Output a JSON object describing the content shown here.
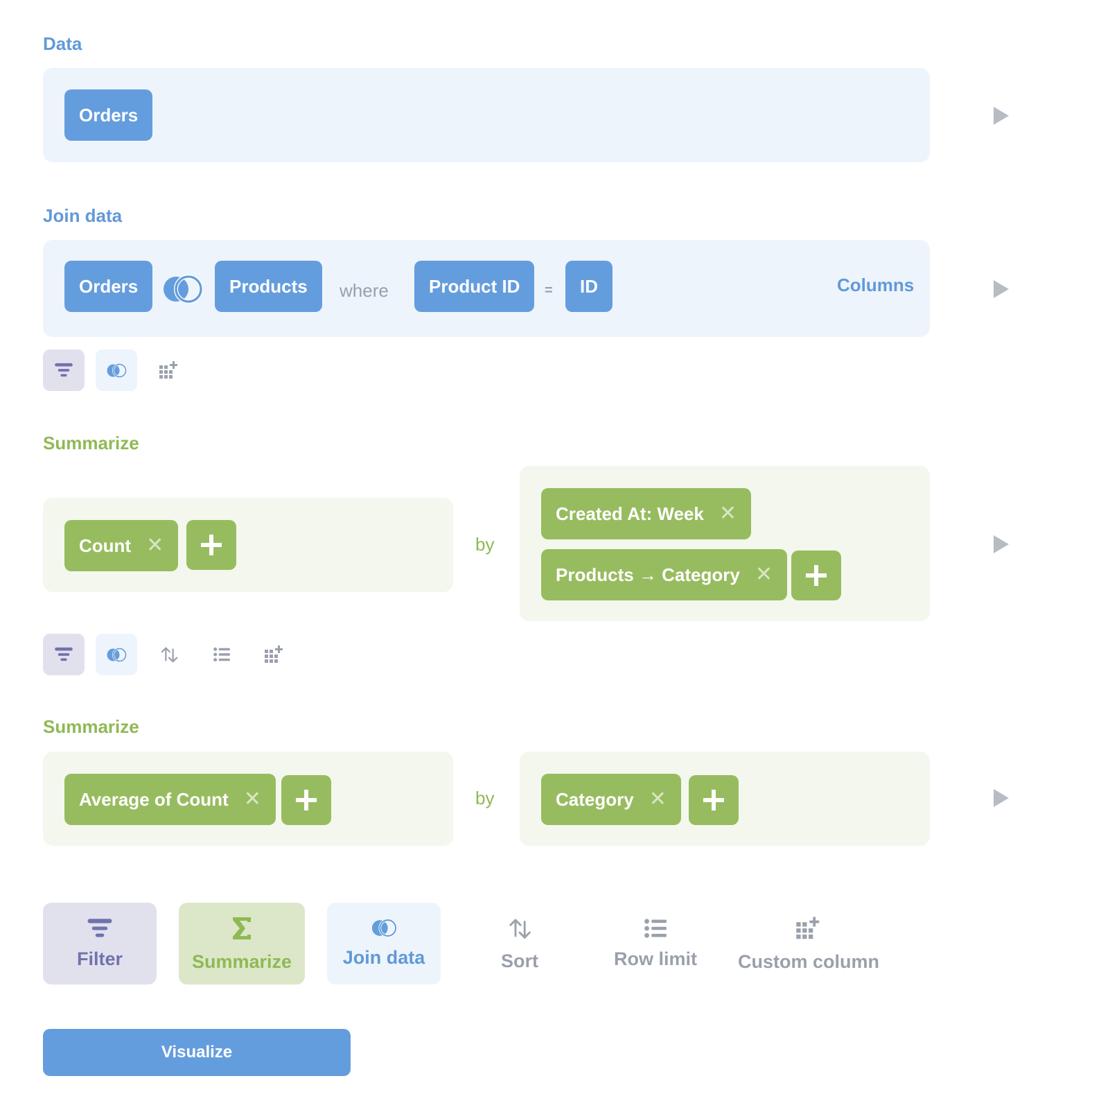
{
  "colors": {
    "data_accent": "#649ddd",
    "summarize_accent": "#97bc5f",
    "filter_accent": "#7172ad",
    "muted": "#9aa0ab"
  },
  "data_step": {
    "title": "Data",
    "source_table": "Orders"
  },
  "join_step": {
    "title": "Join data",
    "left_table": "Orders",
    "join_type_icon": "join-left-icon",
    "right_table": "Products",
    "where_label": "where",
    "left_field": "Product ID",
    "operator": "=",
    "right_field": "ID",
    "columns_label": "Columns",
    "quick_actions": [
      "filter",
      "join",
      "custom-column"
    ]
  },
  "summarize_step_1": {
    "title": "Summarize",
    "metrics": [
      {
        "label": "Count"
      }
    ],
    "by_label": "by",
    "breakouts": [
      {
        "label": "Created At: Week"
      },
      {
        "label": "Products → Category"
      }
    ],
    "quick_actions": [
      "filter",
      "join",
      "sort",
      "row-limit",
      "custom-column"
    ]
  },
  "summarize_step_2": {
    "title": "Summarize",
    "metrics": [
      {
        "label": "Average of Count"
      }
    ],
    "by_label": "by",
    "breakouts": [
      {
        "label": "Category"
      }
    ]
  },
  "actions": {
    "filter": "Filter",
    "summarize": "Summarize",
    "join": "Join data",
    "sort": "Sort",
    "row_limit": "Row limit",
    "custom_column": "Custom column"
  },
  "remove_glyph": "✕",
  "visualize_label": "Visualize"
}
